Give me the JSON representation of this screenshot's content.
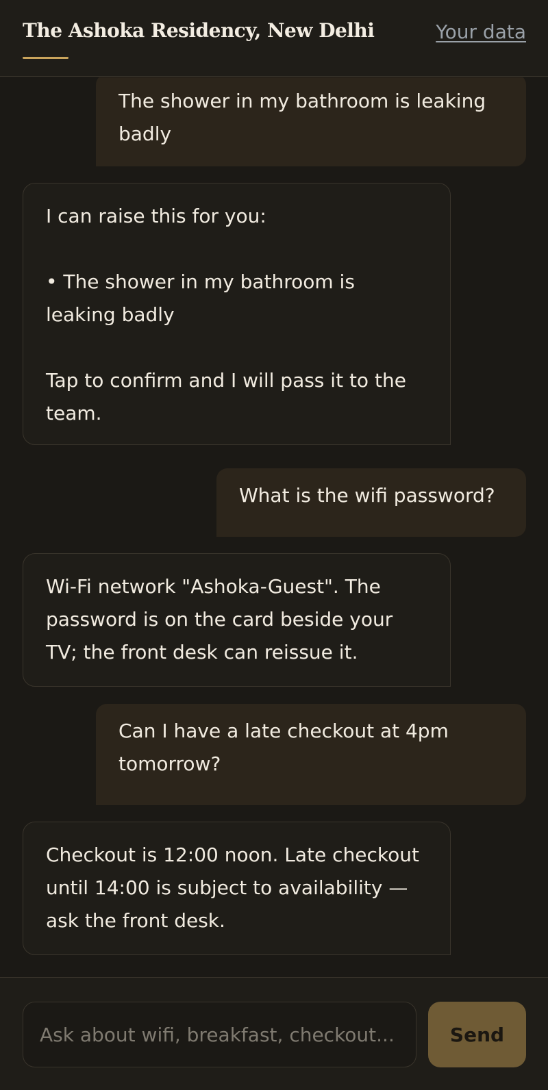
{
  "header": {
    "title": "The Ashoka Residency, New Delhi",
    "data_link": "Your data"
  },
  "messages": [
    {
      "role": "user",
      "text": "The shower in my bathroom is leaking badly"
    },
    {
      "role": "assistant",
      "text": "I can raise this for you:\n\n• The shower in my bathroom is leaking badly\n\nTap to confirm and I will pass it to the team."
    },
    {
      "role": "user",
      "text": "What is the wifi password?"
    },
    {
      "role": "assistant",
      "text": "Wi-Fi network \"Ashoka-Guest\". The password is on the card beside your TV; the front desk can reissue it."
    },
    {
      "role": "user",
      "text": "Can I have a late checkout at 4pm tomorrow?"
    },
    {
      "role": "assistant",
      "text": "Checkout is 12:00 noon. Late checkout until 14:00 is subject to availability — ask the front desk."
    }
  ],
  "composer": {
    "placeholder": "Ask about wifi, breakfast, checkout...",
    "send_label": "Send"
  },
  "colors": {
    "background": "#1b1915",
    "accent": "#c9a45c",
    "user_bubble": "#2c251b",
    "send_button": "#6f5b35"
  }
}
